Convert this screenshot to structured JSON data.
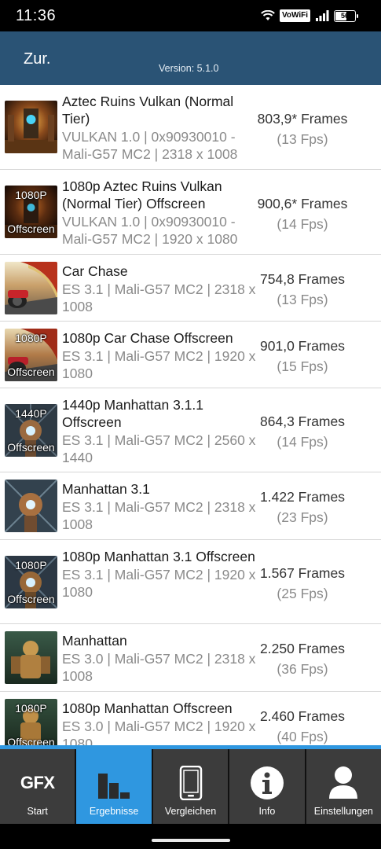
{
  "status_bar": {
    "time": "11:36",
    "vowifi": "VoWiFi",
    "battery": "56"
  },
  "app_bar": {
    "back_label": "Zur.",
    "version": "Version: 5.1.0"
  },
  "results": [
    {
      "title": "Aztec Ruins Vulkan (Normal Tier)",
      "sub": "VULKAN 1.0 | 0x90930010 - Mali-G57 MC2 | 2318 x 1008",
      "frames": "803,9* Frames",
      "fps": "(13 Fps)",
      "thumb": "aztec-thumbnail",
      "overlay_top": "",
      "overlay_bottom": ""
    },
    {
      "title": "1080p Aztec Ruins Vulkan (Normal Tier) Offscreen",
      "sub": "VULKAN 1.0 | 0x90930010 - Mali-G57 MC2 | 1920 x 1080",
      "frames": "900,6* Frames",
      "fps": "(14 Fps)",
      "thumb": "aztec-thumbnail",
      "overlay_top": "1080P",
      "overlay_bottom": "Offscreen"
    },
    {
      "title": "Car Chase",
      "sub": "ES 3.1 | Mali-G57 MC2 | 2318 x 1008",
      "frames": "754,8 Frames",
      "fps": "(13 Fps)",
      "thumb": "car-chase-thumbnail",
      "overlay_top": "",
      "overlay_bottom": ""
    },
    {
      "title": "1080p Car Chase Offscreen",
      "sub": "ES 3.1 | Mali-G57 MC2 | 1920 x 1080",
      "frames": "901,0 Frames",
      "fps": "(15 Fps)",
      "thumb": "car-chase-thumbnail",
      "overlay_top": "1080P",
      "overlay_bottom": "Offscreen"
    },
    {
      "title": "1440p Manhattan 3.1.1 Offscreen",
      "sub": "ES 3.1 | Mali-G57 MC2 | 2560 x 1440",
      "frames": "864,3 Frames",
      "fps": "(14 Fps)",
      "thumb": "manhattan-31-thumbnail",
      "overlay_top": "1440P",
      "overlay_bottom": "Offscreen"
    },
    {
      "title": "Manhattan 3.1",
      "sub": "ES 3.1 | Mali-G57 MC2 | 2318 x 1008",
      "frames": "1.422 Frames",
      "fps": "(23 Fps)",
      "thumb": "manhattan-31-thumbnail",
      "overlay_top": "",
      "overlay_bottom": ""
    },
    {
      "title": "1080p Manhattan 3.1 Offscreen",
      "sub": "ES 3.1 | Mali-G57 MC2 | 1920 x 1080",
      "frames": "1.567 Frames",
      "fps": "(25 Fps)",
      "thumb": "manhattan-31-thumbnail",
      "overlay_top": "1080P",
      "overlay_bottom": "Offscreen"
    },
    {
      "title": "Manhattan",
      "sub": "ES 3.0 | Mali-G57 MC2 | 2318 x 1008",
      "frames": "2.250 Frames",
      "fps": "(36 Fps)",
      "thumb": "manhattan-thumbnail",
      "overlay_top": "",
      "overlay_bottom": ""
    },
    {
      "title": "1080p Manhattan Offscreen",
      "sub": "ES 3.0 | Mali-G57 MC2 | 1920 x 1080",
      "frames": "2.460 Frames",
      "fps": "(40 Fps)",
      "thumb": "manhattan-thumbnail",
      "overlay_top": "1080P",
      "overlay_bottom": "Offscreen"
    }
  ],
  "bottom_nav": [
    {
      "label": "Start",
      "icon": "gfx-logo-icon",
      "icon_text": "GFX",
      "active": false
    },
    {
      "label": "Ergebnisse",
      "icon": "bar-chart-icon",
      "active": true
    },
    {
      "label": "Vergleichen",
      "icon": "phone-icon",
      "active": false
    },
    {
      "label": "Info",
      "icon": "info-icon",
      "active": false
    },
    {
      "label": "Einstellungen",
      "icon": "person-icon",
      "active": false
    }
  ],
  "colors": {
    "app_bar": "#2a5375",
    "accent": "#2f97e0",
    "nav_bg": "#3c3c3c"
  }
}
